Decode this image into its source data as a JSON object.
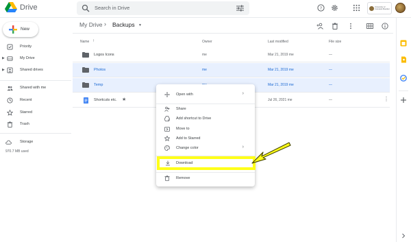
{
  "header": {
    "app_name": "Drive",
    "search_placeholder": "Search in Drive",
    "org_logo_text": "University of Colorado Boulder",
    "icons": [
      "help-icon",
      "settings-icon",
      "apps-icon"
    ]
  },
  "sidebar": {
    "new_label": "New",
    "items": [
      {
        "label": "Priority",
        "icon": "priority-icon"
      },
      {
        "label": "My Drive",
        "icon": "my-drive-icon"
      },
      {
        "label": "Shared drives",
        "icon": "shared-drives-icon"
      },
      {
        "label": "Shared with me",
        "icon": "shared-with-me-icon"
      },
      {
        "label": "Recent",
        "icon": "recent-icon"
      },
      {
        "label": "Starred",
        "icon": "star-icon"
      },
      {
        "label": "Trash",
        "icon": "trash-icon"
      },
      {
        "label": "Storage",
        "icon": "cloud-icon"
      }
    ],
    "storage_usage": "970.7 MB used"
  },
  "breadcrumb": {
    "root": "My Drive",
    "separator": "›",
    "current": "Backups"
  },
  "table": {
    "columns": {
      "name": "Name",
      "sort_arrow": "↑",
      "owner": "Owner",
      "modified": "Last modified",
      "size": "File size"
    },
    "rows": [
      {
        "name": "Logos Icons",
        "owner": "me",
        "modified": "Mar 21, 2019 me",
        "size": "—",
        "type": "folder",
        "selected": false
      },
      {
        "name": "Photos",
        "owner": "me",
        "modified": "Mar 21, 2019 me",
        "size": "—",
        "type": "folder",
        "selected": true
      },
      {
        "name": "Temp",
        "owner": "me",
        "modified": "Mar 21, 2019 me",
        "size": "—",
        "type": "folder",
        "selected": true
      },
      {
        "name": "Shortcuts etc.",
        "owner": "me",
        "modified": "Jul 26, 2021 me",
        "size": "—",
        "type": "doc",
        "selected": false,
        "starred": true
      }
    ]
  },
  "context_menu": {
    "items": [
      {
        "label": "Open with",
        "icon": "open-with-icon",
        "submenu": true
      },
      {
        "label": "Share",
        "icon": "share-icon"
      },
      {
        "label": "Add shortcut to Drive",
        "icon": "add-shortcut-icon"
      },
      {
        "label": "Move to",
        "icon": "move-to-icon"
      },
      {
        "label": "Add to Starred",
        "icon": "star-outline-icon"
      },
      {
        "label": "Change color",
        "icon": "palette-icon",
        "submenu": true
      },
      {
        "label": "Download",
        "icon": "download-icon"
      },
      {
        "label": "Remove",
        "icon": "remove-icon"
      }
    ]
  },
  "colors": {
    "selected_row": "#e8f0fe",
    "selected_text": "#1967d2",
    "highlight": "#ffff1a"
  }
}
